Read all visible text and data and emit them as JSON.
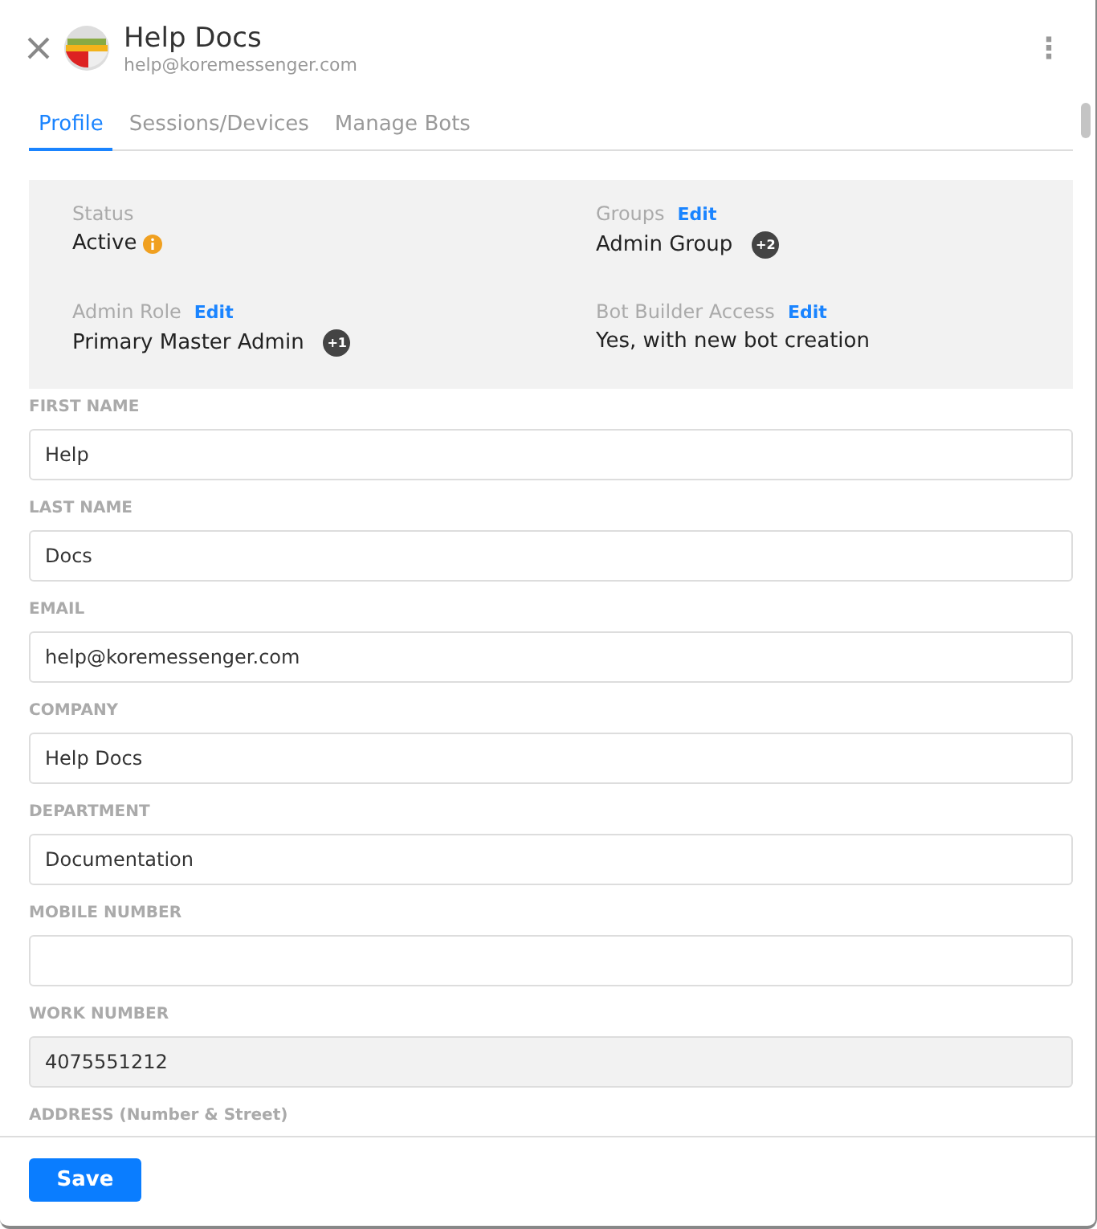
{
  "header": {
    "title": "Help Docs",
    "subtitle": "help@koremessenger.com",
    "menu_glyph": "⋮"
  },
  "tabs": [
    {
      "label": "Profile",
      "selected": true
    },
    {
      "label": "Sessions/Devices",
      "selected": false
    },
    {
      "label": "Manage Bots",
      "selected": false
    }
  ],
  "summary": [
    {
      "label": "Status",
      "value": "Active",
      "info": true
    },
    {
      "label": "Groups",
      "edit": "Edit",
      "value": "Admin Group",
      "badge": "+2"
    },
    {
      "label": "Admin Role",
      "edit": "Edit",
      "value": "Primary Master Admin",
      "badge": "+1"
    },
    {
      "label": "Bot Builder Access",
      "edit": "Edit",
      "value": "Yes, with new bot creation"
    }
  ],
  "fields": [
    {
      "label": "FIRST NAME",
      "value": "Help",
      "disabled": false
    },
    {
      "label": "LAST NAME",
      "value": "Docs",
      "disabled": false
    },
    {
      "label": "EMAIL",
      "value": "help@koremessenger.com",
      "disabled": false
    },
    {
      "label": "COMPANY",
      "value": "Help Docs",
      "disabled": false
    },
    {
      "label": "DEPARTMENT",
      "value": "Documentation",
      "disabled": false
    },
    {
      "label": "MOBILE NUMBER",
      "disabled": false
    },
    {
      "label": "WORK NUMBER",
      "value": "4075551212",
      "disabled": true
    },
    {
      "label": "ADDRESS (Number & Street)"
    }
  ],
  "footer": {
    "save": "Save"
  }
}
